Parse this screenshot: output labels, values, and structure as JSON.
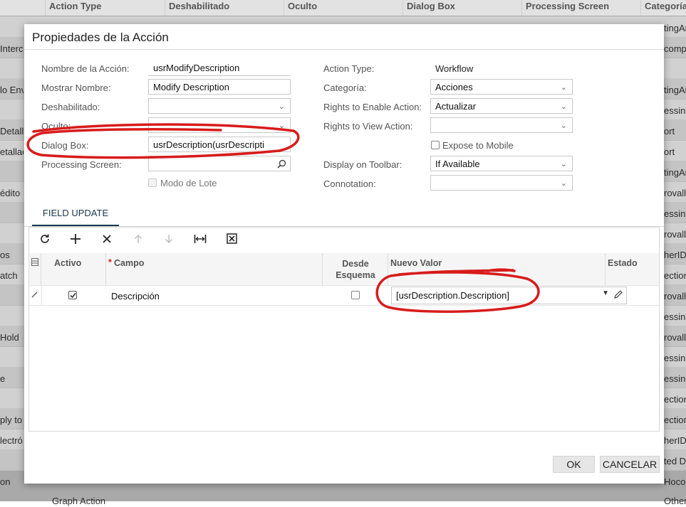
{
  "background": {
    "columns": [
      "Action Type",
      "Deshabilitado",
      "Oculto",
      "Dialog Box",
      "Processing Screen",
      "Categoría"
    ],
    "left_texts": [
      "Interc",
      "lo Env",
      "Detall",
      "etallad",
      "édito",
      "os",
      "atch",
      "Hold",
      "e",
      "ply to",
      "lectró",
      "on",
      "Graph Action"
    ],
    "right_texts": [
      "tingAr",
      "comp",
      "tingAr",
      "essin",
      "ort",
      "ort",
      "tingAr",
      "rovall",
      "essin",
      "rovall",
      "herID",
      "ection",
      "rovall",
      "essin",
      "rovall",
      "essin",
      "essin",
      "ection",
      "ection",
      "herID",
      "ted D",
      "Hocon",
      "OtherID"
    ]
  },
  "dialog": {
    "title": "Propiedades de la Acción",
    "left_form": {
      "action_name_label": "Nombre de la Acción:",
      "action_name_value": "usrModifyDescription",
      "display_name_label": "Mostrar Nombre:",
      "display_name_value": "Modify Description",
      "disabled_label": "Deshabilitado:",
      "disabled_value": "",
      "hidden_label": "Oculto:",
      "hidden_value": "",
      "dialog_box_label": "Dialog Box:",
      "dialog_box_value": "usrDescription(usrDescripti",
      "processing_screen_label": "Processing Screen:",
      "processing_screen_value": "",
      "batch_mode_label": "Modo de Lote",
      "batch_mode_checked": false
    },
    "right_form": {
      "action_type_label": "Action Type:",
      "action_type_value": "Workflow",
      "category_label": "Categoría:",
      "category_value": "Acciones",
      "rights_enable_label": "Rights to Enable Action:",
      "rights_enable_value": "Actualizar",
      "rights_view_label": "Rights to View Action:",
      "rights_view_value": "",
      "expose_mobile_label": "Expose to Mobile",
      "expose_mobile_checked": false,
      "display_toolbar_label": "Display on Toolbar:",
      "display_toolbar_value": "If Available",
      "connotation_label": "Connotation:",
      "connotation_value": ""
    },
    "tab_label": "FIELD UPDATE",
    "grid": {
      "toolbar_icons": [
        "refresh-icon",
        "add-icon",
        "delete-icon",
        "arrow-up-icon",
        "arrow-down-icon",
        "fit-columns-icon",
        "excel-export-icon"
      ],
      "columns": {
        "active": "Activo",
        "required_mark": "*",
        "field": "Campo",
        "from_schema": "Desde Esquema",
        "new_value": "Nuevo Valor",
        "status": "Estado"
      },
      "rows": [
        {
          "active": true,
          "field": "Descripción",
          "from_schema": false,
          "new_value": "[usrDescription.Description]"
        }
      ]
    },
    "buttons": {
      "ok": "OK",
      "cancel": "CANCELAR"
    }
  },
  "annotations": {
    "color": "#d81b1b"
  }
}
